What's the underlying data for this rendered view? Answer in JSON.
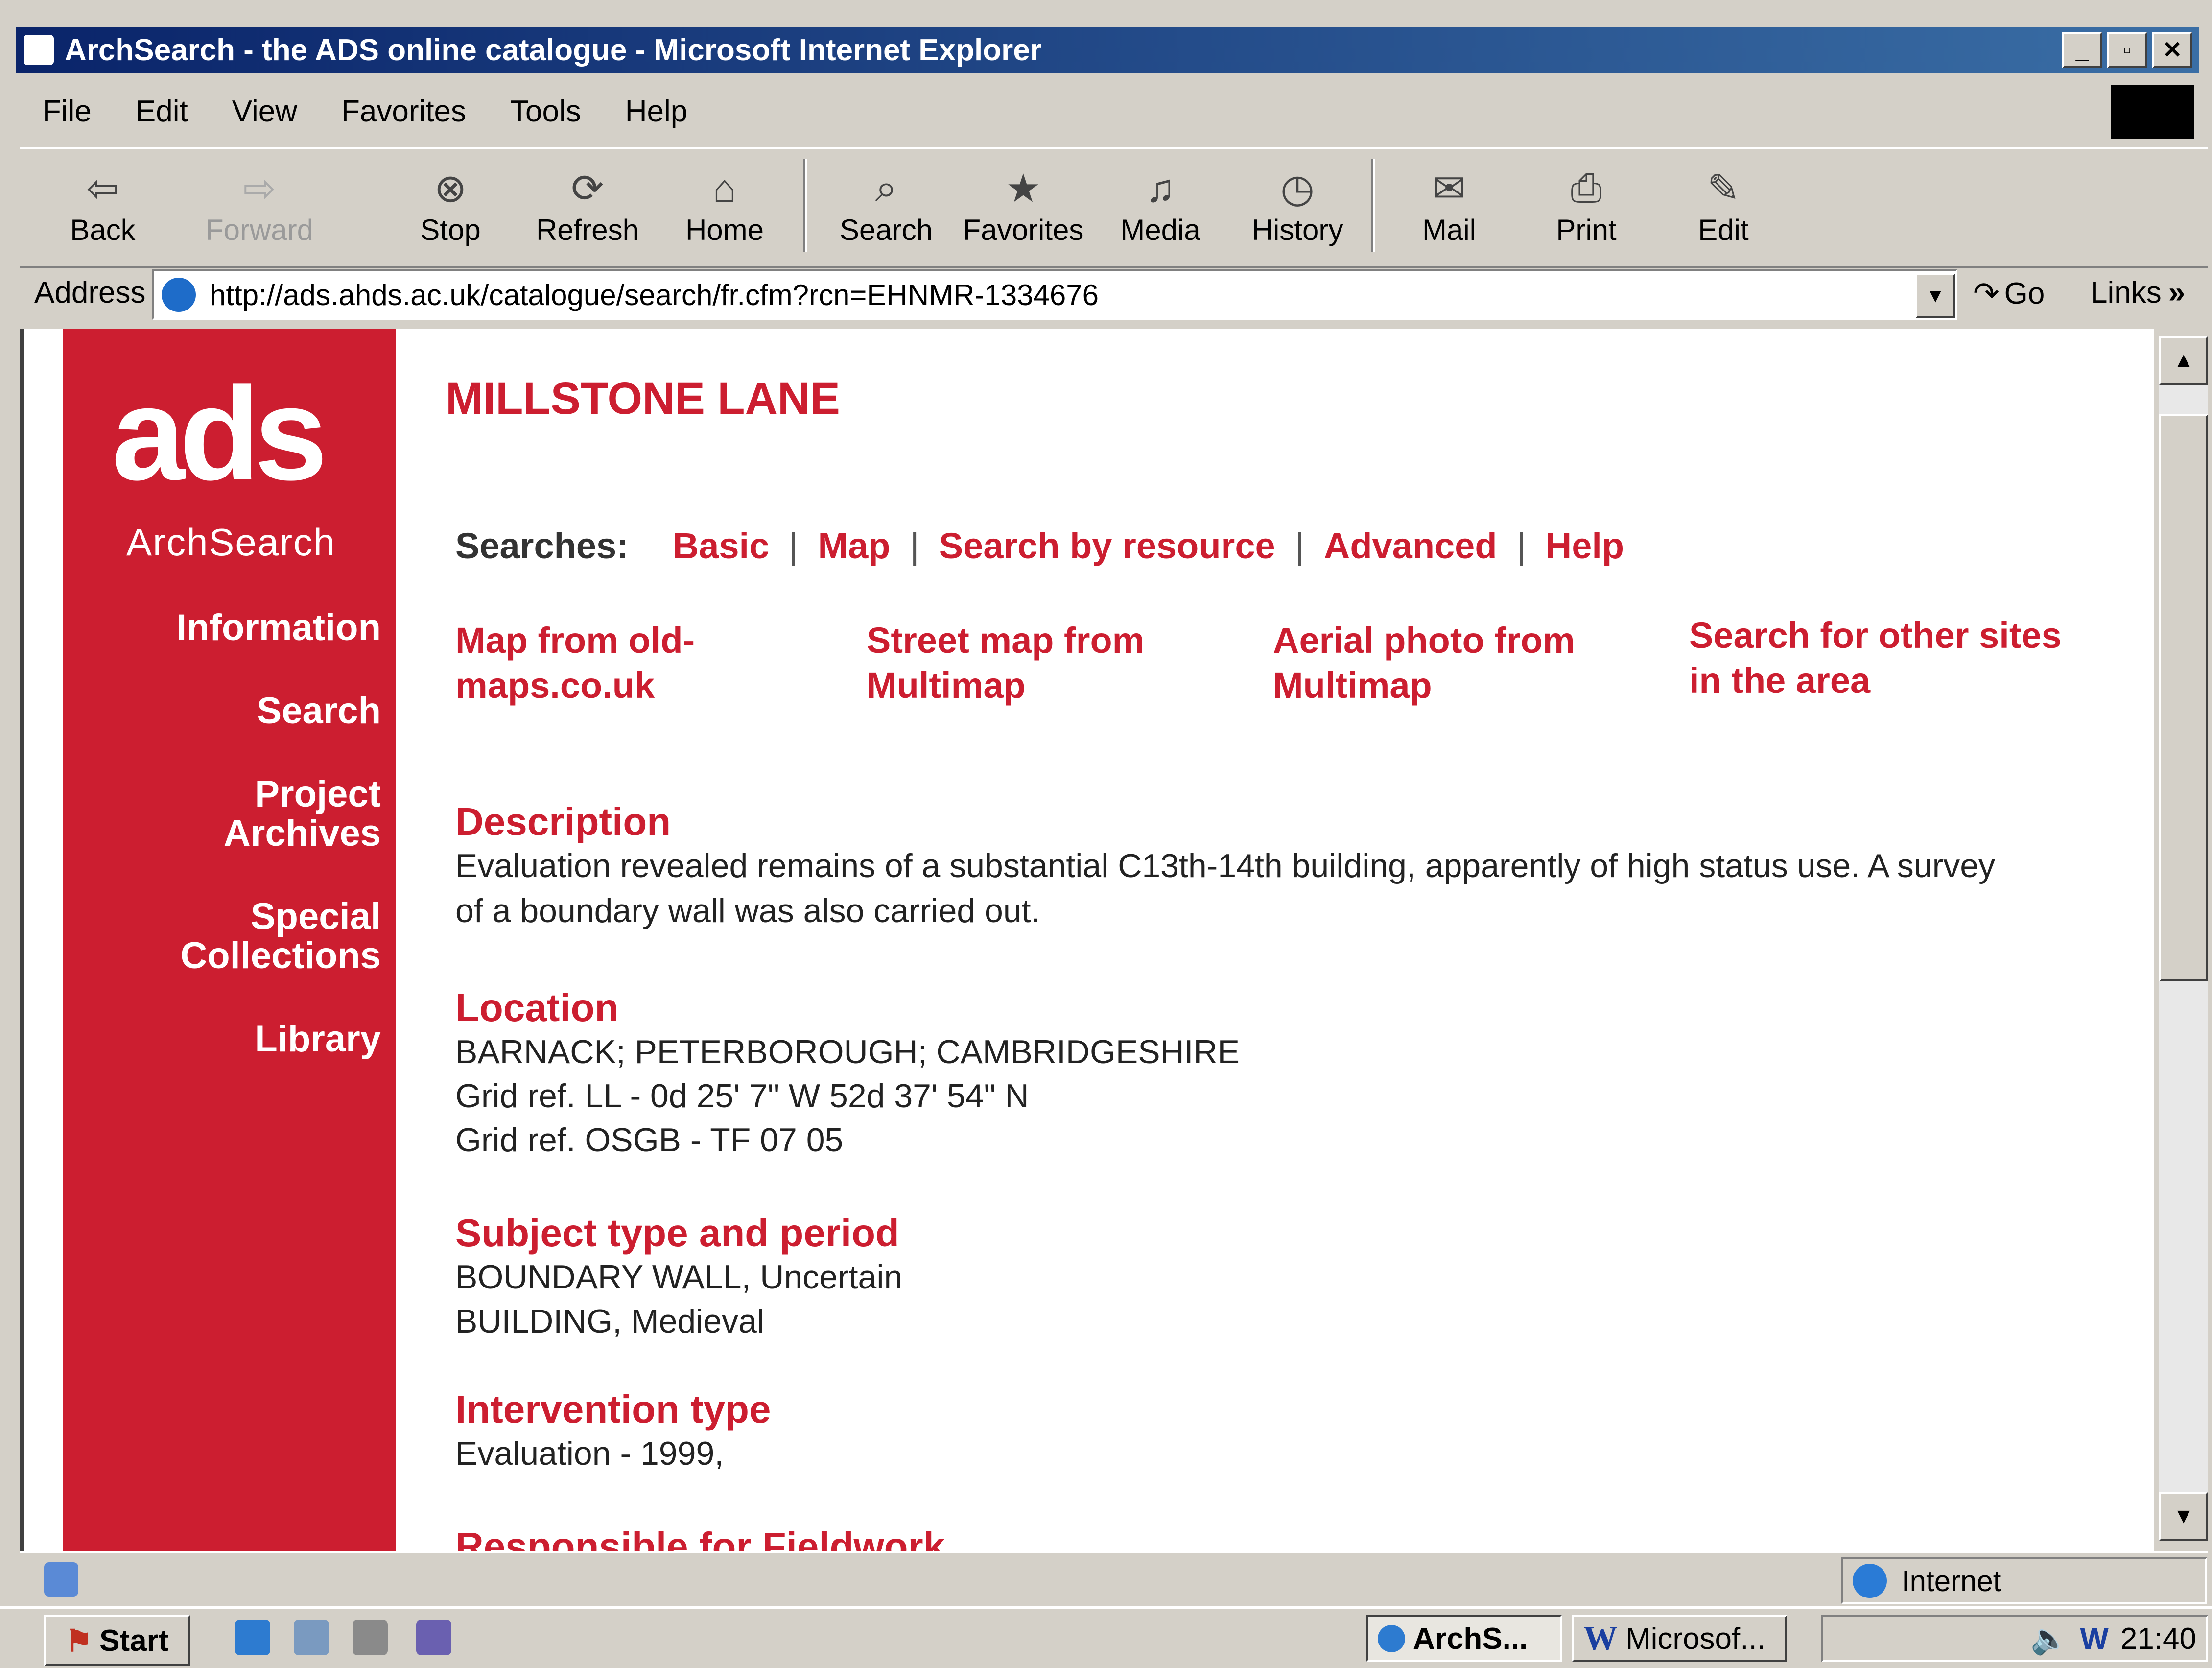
{
  "window": {
    "title": "ArchSearch - the ADS online catalogue - Microsoft Internet Explorer",
    "controls": [
      "_",
      "▫",
      "✕"
    ]
  },
  "menu": [
    "File",
    "Edit",
    "View",
    "Favorites",
    "Tools",
    "Help"
  ],
  "toolbar": {
    "back": "Back",
    "forward": "Forward",
    "stop": "Stop",
    "refresh": "Refresh",
    "home": "Home",
    "search": "Search",
    "favorites": "Favorites",
    "media": "Media",
    "history": "History",
    "mail": "Mail",
    "print": "Print",
    "edit": "Edit"
  },
  "address": {
    "label": "Address",
    "url": "http://ads.ahds.ac.uk/catalogue/search/fr.cfm?rcn=EHNMR-1334676",
    "go": "Go",
    "links": "Links"
  },
  "sidebar": {
    "logo": "ads",
    "subtitle": "ArchSearch",
    "items": [
      {
        "label": "Information"
      },
      {
        "label": "Search"
      },
      {
        "label": "Project\nArchives"
      },
      {
        "label": "Special\nCollections"
      },
      {
        "label": "Library"
      }
    ]
  },
  "page": {
    "title": "MILLSTONE LANE",
    "searches_label": "Searches:",
    "search_links": [
      "Basic",
      "Map",
      "Search by resource",
      "Advanced",
      "Help"
    ],
    "map_links": [
      "Map from old-\nmaps.co.uk",
      "Street map from\nMultimap",
      "Aerial photo from\nMultimap",
      "Search for other sites\nin the area"
    ],
    "sections": {
      "description": {
        "heading": "Description",
        "text": "Evaluation revealed remains of a substantial C13th-14th building, apparently of high status use. A survey\nof a boundary wall was also carried out."
      },
      "location": {
        "heading": "Location",
        "lines": [
          "BARNACK; PETERBOROUGH; CAMBRIDGESHIRE",
          "Grid ref. LL - 0d 25' 7\" W 52d 37' 54\" N",
          "Grid ref. OSGB - TF 07 05"
        ]
      },
      "subject": {
        "heading": "Subject type and period",
        "lines": [
          "BOUNDARY WALL, Uncertain",
          "BUILDING, Medieval"
        ]
      },
      "intervention": {
        "heading": "Intervention type",
        "lines": [
          "Evaluation - 1999,"
        ]
      },
      "responsible": {
        "heading": "Responsible for Fieldwork"
      }
    }
  },
  "status": {
    "zone": "Internet"
  },
  "taskbar": {
    "start": "Start",
    "tasks": [
      "ArchS...",
      "Microsof..."
    ],
    "clock": "21:40"
  }
}
